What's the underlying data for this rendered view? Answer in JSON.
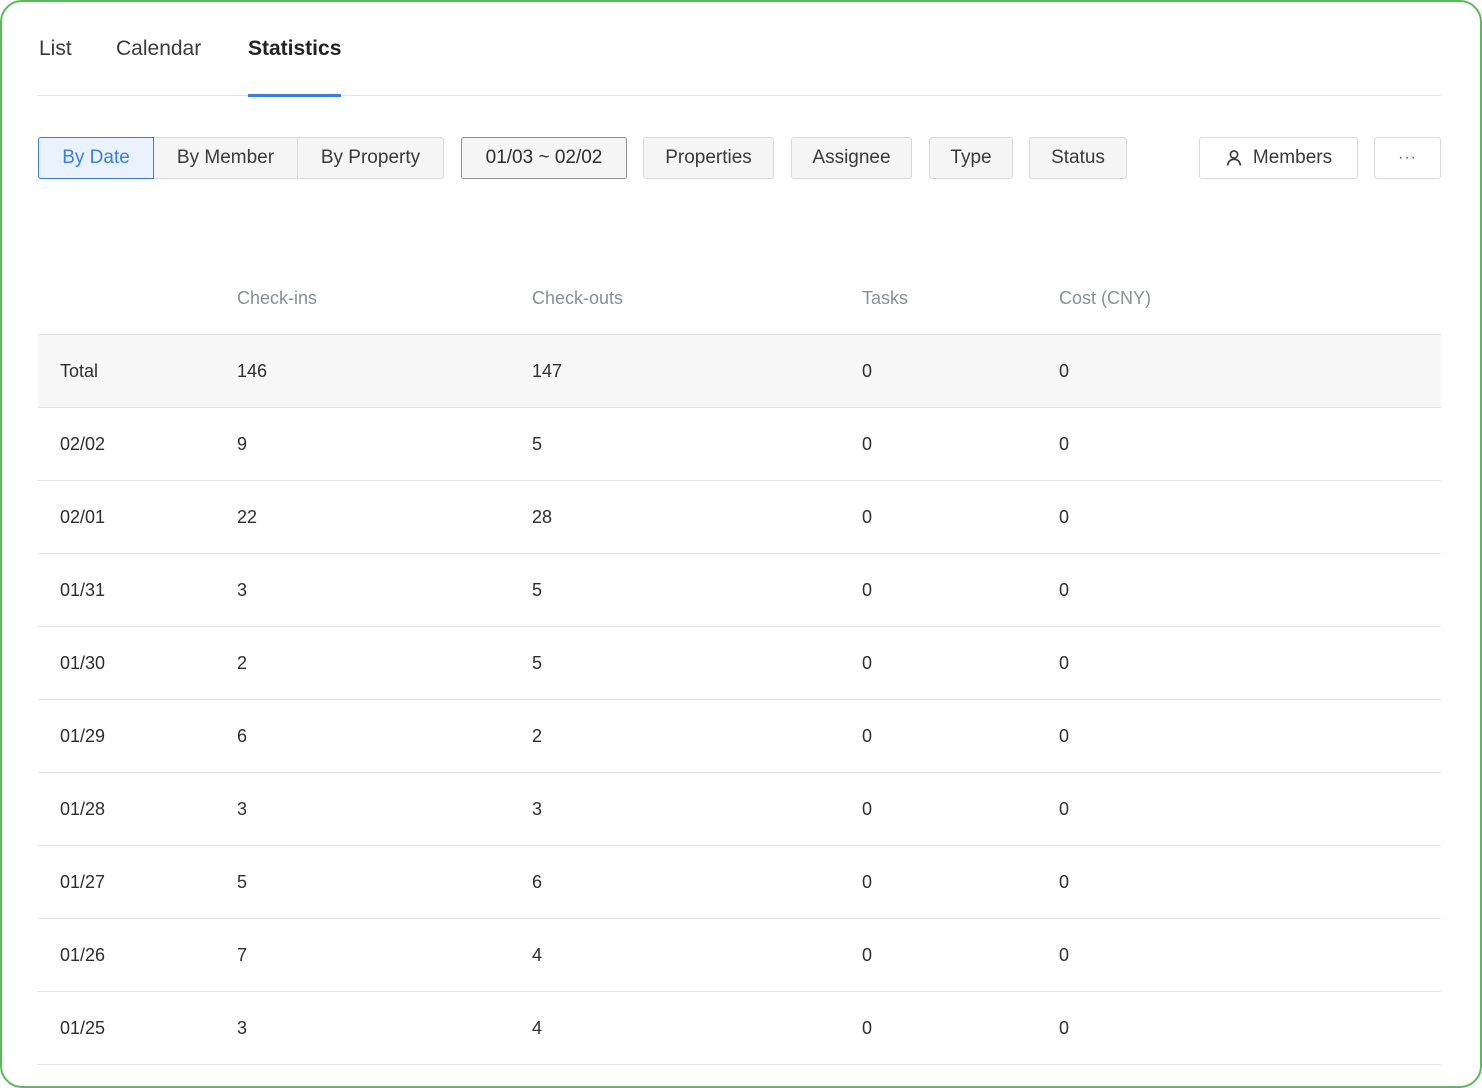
{
  "tabs": [
    {
      "label": "List",
      "active": false
    },
    {
      "label": "Calendar",
      "active": false
    },
    {
      "label": "Statistics",
      "active": true
    }
  ],
  "toolbar": {
    "group_by": [
      {
        "label": "By Date",
        "active": true
      },
      {
        "label": "By Member",
        "active": false
      },
      {
        "label": "By Property",
        "active": false
      }
    ],
    "date_range": "01/03 ~ 02/02",
    "filters": [
      "Properties",
      "Assignee",
      "Type",
      "Status"
    ],
    "members_label": "Members",
    "more_label": "···"
  },
  "table": {
    "columns": [
      "",
      "Check-ins",
      "Check-outs",
      "Tasks",
      "Cost (CNY)"
    ],
    "rows": [
      [
        "Total",
        "146",
        "147",
        "0",
        "0"
      ],
      [
        "02/02",
        "9",
        "5",
        "0",
        "0"
      ],
      [
        "02/01",
        "22",
        "28",
        "0",
        "0"
      ],
      [
        "01/31",
        "3",
        "5",
        "0",
        "0"
      ],
      [
        "01/30",
        "2",
        "5",
        "0",
        "0"
      ],
      [
        "01/29",
        "6",
        "2",
        "0",
        "0"
      ],
      [
        "01/28",
        "3",
        "3",
        "0",
        "0"
      ],
      [
        "01/27",
        "5",
        "6",
        "0",
        "0"
      ],
      [
        "01/26",
        "7",
        "4",
        "0",
        "0"
      ],
      [
        "01/25",
        "3",
        "4",
        "0",
        "0"
      ]
    ]
  },
  "colors": {
    "accent": "#3a7de1",
    "frame_border": "#5cb85c"
  },
  "icons": {
    "members": "user-icon"
  }
}
